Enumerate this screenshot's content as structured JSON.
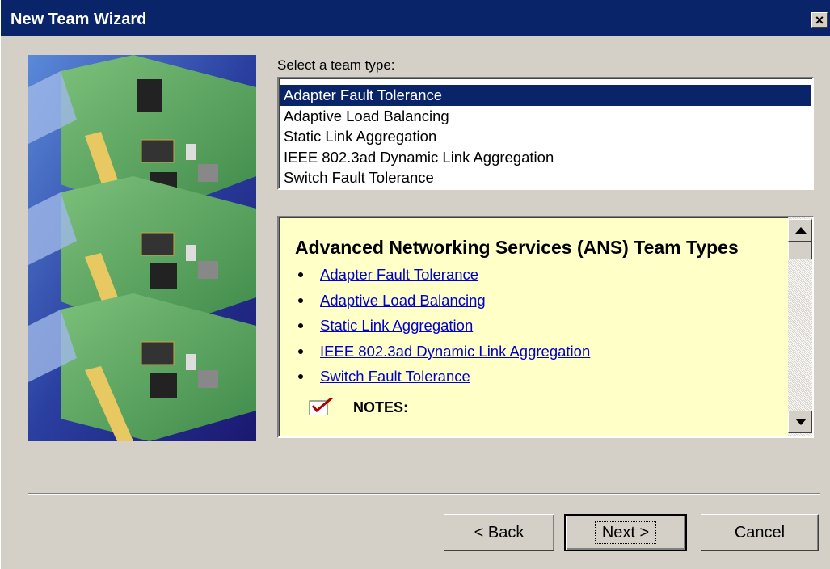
{
  "window": {
    "title": "New Team Wizard",
    "close_label": "×"
  },
  "team_select": {
    "label": "Select a team type:",
    "options": [
      "Adapter Fault Tolerance",
      "Adaptive Load Balancing",
      "Static Link Aggregation",
      "IEEE 802.3ad Dynamic Link Aggregation",
      "Switch Fault Tolerance"
    ],
    "selected": "Adapter Fault Tolerance"
  },
  "info": {
    "heading": "Advanced Networking Services (ANS) Team Types",
    "links": [
      "Adapter Fault Tolerance",
      "Adaptive Load Balancing",
      "Static Link Aggregation",
      "IEEE 802.3ad Dynamic Link Aggregation",
      "Switch Fault Tolerance"
    ],
    "notes_label": "NOTES:"
  },
  "buttons": {
    "back": "< Back",
    "next": "Next >",
    "cancel": "Cancel"
  },
  "colors": {
    "titlebar": "#0a246a",
    "dialog_bg": "#d4d0c8",
    "info_bg": "#ffffc8",
    "link": "#0000cc"
  }
}
